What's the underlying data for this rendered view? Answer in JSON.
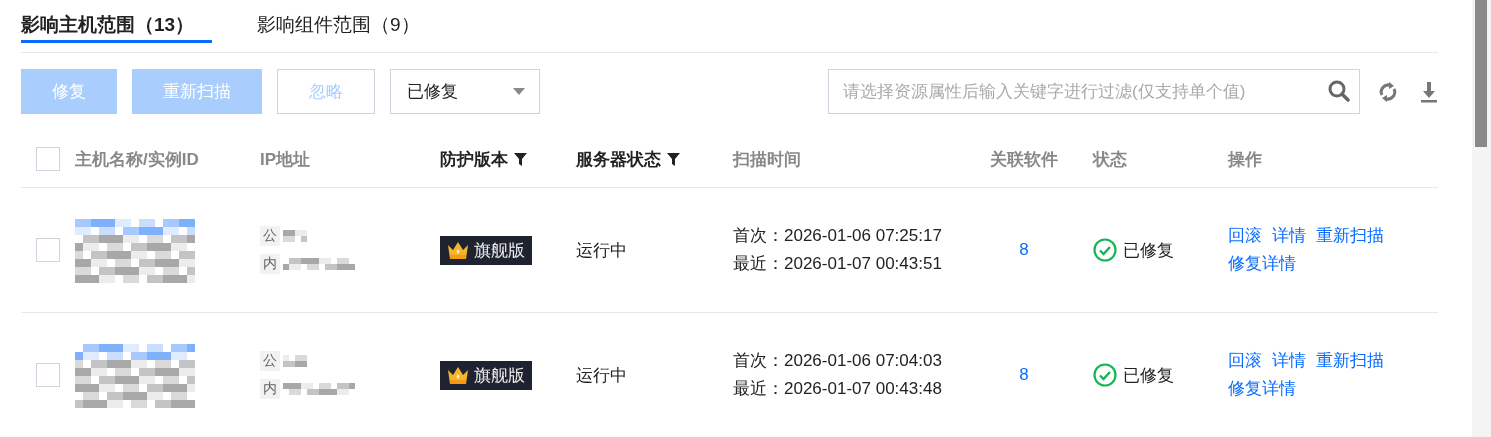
{
  "tabs": [
    {
      "label": "影响主机范围（13）",
      "selected": true
    },
    {
      "label": "影响组件范围（9）",
      "selected": false
    }
  ],
  "toolbar": {
    "buttons": [
      {
        "label": "修复",
        "kind": "primary",
        "disabled": true
      },
      {
        "label": "重新扫描",
        "kind": "primary",
        "disabled": true
      },
      {
        "label": "忽略",
        "kind": "default",
        "disabled": true
      }
    ],
    "status_select": {
      "value": "已修复"
    },
    "search": {
      "placeholder": "请选择资源属性后输入关键字进行过滤(仅支持单个值)"
    }
  },
  "table": {
    "select_all": {
      "checked": false
    },
    "columns": [
      {
        "label": "主机名称/实例ID",
        "filterable": false
      },
      {
        "label": "IP地址",
        "filterable": false
      },
      {
        "label": "防护版本",
        "filterable": true
      },
      {
        "label": "服务器状态",
        "filterable": true
      },
      {
        "label": "扫描时间",
        "filterable": false
      },
      {
        "label": "关联软件",
        "filterable": false
      },
      {
        "label": "状态",
        "filterable": false
      },
      {
        "label": "操作",
        "filterable": false
      }
    ],
    "rows": [
      {
        "selected": false,
        "ip_public_label": "公",
        "ip_private_label": "内",
        "edition": "旗舰版",
        "server_status": "运行中",
        "first_scan_label": "首次：",
        "first_scan": "2026-01-06 07:25:17",
        "last_scan_label": "最近：",
        "last_scan": "2026-01-07 00:43:51",
        "software_count": "8",
        "status": "已修复",
        "actions": [
          "回滚",
          "详情",
          "重新扫描",
          "修复详情"
        ]
      },
      {
        "selected": false,
        "ip_public_label": "公",
        "ip_private_label": "内",
        "edition": "旗舰版",
        "server_status": "运行中",
        "first_scan_label": "首次：",
        "first_scan": "2026-01-06 07:04:03",
        "last_scan_label": "最近：",
        "last_scan": "2026-01-07 00:43:48",
        "software_count": "8",
        "status": "已修复",
        "actions": [
          "回滚",
          "详情",
          "重新扫描",
          "修复详情"
        ]
      }
    ]
  }
}
